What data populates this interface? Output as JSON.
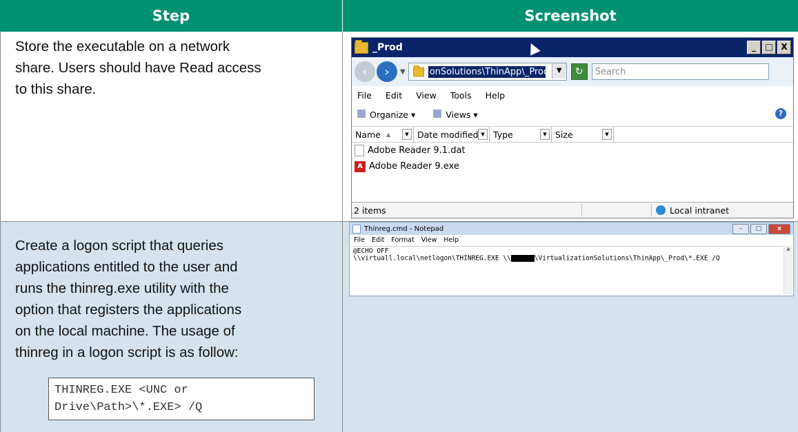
{
  "table": {
    "headers": [
      "Step",
      "Screenshot"
    ],
    "rows": [
      {
        "step_lines": [
          "Store the executable on a network",
          "share. Users should have Read access",
          "to this share."
        ]
      },
      {
        "step_lines": [
          "Create a logon script that queries",
          "applications entitled to the user and",
          "runs the thinreg.exe utility with the",
          "option that registers the applications",
          "on the local machine. The usage of",
          "thinreg in a logon script is as follow:"
        ],
        "code_lines": [
          "THINREG.EXE <UNC or",
          "Drive\\Path>\\*.EXE> /Q"
        ]
      }
    ]
  },
  "explorer": {
    "title": "_Prod",
    "window_buttons": [
      "_",
      "□",
      "X"
    ],
    "address": "onSolutions\\ThinApp\\_Prod",
    "search_placeholder": "Search",
    "menu": [
      "File",
      "Edit",
      "View",
      "Tools",
      "Help"
    ],
    "toolbar": {
      "organize": "Organize ▾",
      "views": "Views ▾"
    },
    "columns": [
      "Name",
      "Date modified",
      "Type",
      "Size"
    ],
    "files": [
      "Adobe Reader 9.1.dat",
      "Adobe Reader 9.exe"
    ],
    "status_count": "2 items",
    "status_zone": "Local intranet"
  },
  "notepad": {
    "title": "Thinreg.cmd - Notepad",
    "menu": [
      "File",
      "Edit",
      "Format",
      "View",
      "Help"
    ],
    "line1": "@ECHO OFF",
    "line2_a": "\\\\virtuall.local\\netlogon\\THINREG.EXE \\\\",
    "line2_b": "\\VirtualizationSolutions\\ThinApp\\_Prod\\*.EXE /Q"
  },
  "colors": {
    "header_bg": "#009173",
    "row2_bg": "#d6e2ee",
    "titlebar": "#0a246a"
  }
}
